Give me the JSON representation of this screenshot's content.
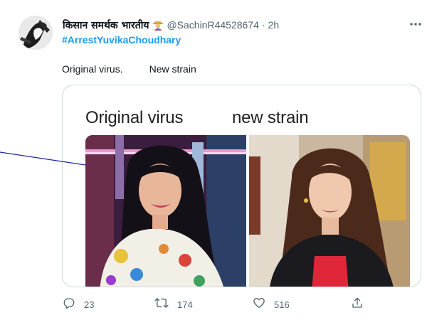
{
  "tweet": {
    "author": {
      "display_name": "किसान समर्थक भारतीय",
      "badge_emoji": "farmer-emoji",
      "handle": "@SachinR44528674",
      "separator": "·",
      "time": "2h"
    },
    "hashtag": "#ArrestYuvikaChoudhary",
    "text_part1": "Original virus.",
    "text_part2": "New strain",
    "media": {
      "label_left": "Original virus",
      "label_right": "new strain"
    },
    "actions": {
      "reply_count": "23",
      "retweet_count": "174",
      "like_count": "516"
    }
  },
  "colors": {
    "text_primary": "#0f1419",
    "text_secondary": "#536471",
    "link_blue": "#1d9bf0",
    "annotation_line": "#1a2a9e"
  },
  "icons": {
    "reply": "reply-icon",
    "retweet": "retweet-icon",
    "like": "heart-icon",
    "share": "share-icon",
    "more": "more-icon"
  }
}
